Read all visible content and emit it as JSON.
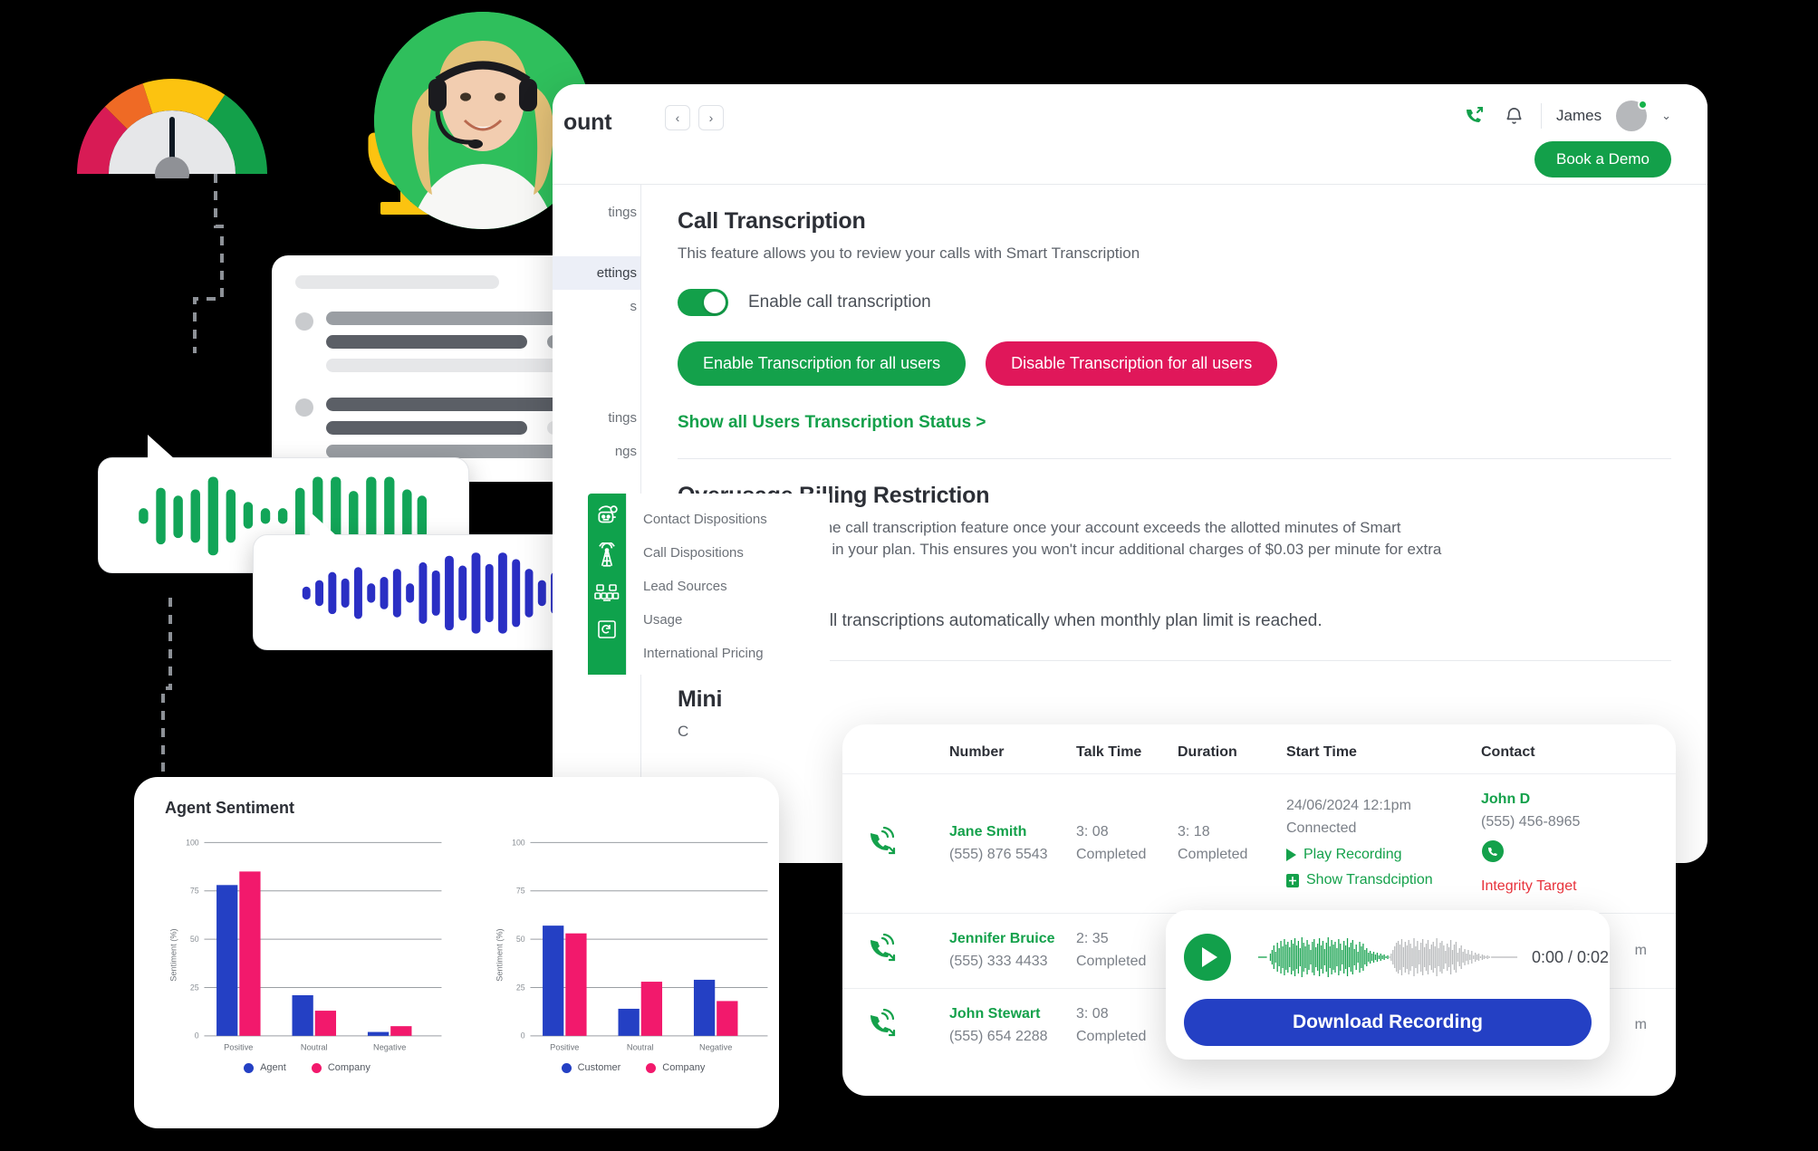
{
  "app": {
    "title": "ount",
    "pager": {
      "prev": "‹",
      "next": "›"
    },
    "user": "James",
    "caret": "⌄",
    "book_demo": "Book a Demo"
  },
  "sidebar": {
    "items": [
      {
        "label": "tings",
        "active": false
      },
      {
        "label": "ettings",
        "active": true
      },
      {
        "label": "s",
        "active": false
      },
      {
        "label": "tings",
        "active": false
      },
      {
        "label": "ngs",
        "active": false
      },
      {
        "label": "Contact Dispositions",
        "active": false
      },
      {
        "label": "Call Dispositions",
        "active": false
      },
      {
        "label": "Lead Sources",
        "active": false
      },
      {
        "label": "Usage",
        "active": false
      },
      {
        "label": "International Pricing",
        "active": false
      }
    ],
    "icons": [
      "robot-icon",
      "tower-icon",
      "grid-icon",
      "refresh-icon"
    ]
  },
  "transcription": {
    "title": "Call Transcription",
    "subtitle": "This feature allows you to review your calls with Smart Transcription",
    "toggle_label": "Enable call transcription",
    "toggle_on": true,
    "enable_all": "Enable Transcription for all users",
    "disable_all": "Disable Transcription for all users",
    "status_link": "Show all Users Transcription Status >"
  },
  "overusage": {
    "title": "Overusage Billing Restriction",
    "body": "Automatically pause the call transcription feature once your account exceeds the allotted minutes of Smart Transcription included in your plan. This ensures you won't incur additional charges of $0.03 per minute for extra transcription minutes.",
    "toggle_label": "Turn off call transcriptions automatically when monthly plan limit is reached.",
    "toggle_on": false
  },
  "third_section": {
    "title": "Mini",
    "sub": "C"
  },
  "calls": {
    "columns": [
      "Number",
      "Talk Time",
      "Duration",
      "Start Time",
      "Contact"
    ],
    "rows": [
      {
        "icon": "incoming-call-icon",
        "name": "Jane Smith",
        "number": "(555) 876 5543",
        "talk_time": "3: 08",
        "talk_status": "Completed",
        "duration": "3: 18",
        "duration_status": "Completed",
        "start_time": "24/06/2024 12:1pm",
        "start_status": "Connected",
        "play": "Play Recording",
        "transcript": "Show Transdciption",
        "contact_name": "John D",
        "contact_number": "(555) 456-8965",
        "contact_tag": "Integrity Target"
      },
      {
        "icon": "incoming-call-icon",
        "name": "Jennifer Bruice",
        "number": "(555) 333 4433",
        "talk_time": "2: 35",
        "talk_status": "Completed",
        "duration": "",
        "duration_status": "",
        "start_time": "m",
        "start_status": "",
        "play": "",
        "transcript": "",
        "contact_name": "",
        "contact_number": "",
        "contact_tag": ""
      },
      {
        "icon": "incoming-call-icon",
        "name": "John Stewart",
        "number": "(555) 654 2288",
        "talk_time": "3: 08",
        "talk_status": "Completed",
        "duration": "",
        "duration_status": "",
        "start_time": "m",
        "start_status": "",
        "play": "",
        "transcript": "",
        "contact_name": "",
        "contact_number": "",
        "contact_tag": ""
      }
    ]
  },
  "player": {
    "play_icon": "play-icon",
    "time": "0:00 / 0:02",
    "download": "Download Recording",
    "played_color": "#12a04b",
    "remaining_color": "#b6b8ba"
  },
  "sentiment": {
    "title": "Agent Sentiment"
  },
  "colors": {
    "brand_green": "#13a04a",
    "pink": "#e0175a",
    "blue": "#2440c4",
    "red": "#e8333c"
  },
  "chart_data": [
    {
      "type": "bar",
      "title": "Agent Sentiment",
      "categories": [
        "Positive",
        "Noutral",
        "Negative"
      ],
      "series": [
        {
          "name": "Agent",
          "color": "#2440c4",
          "values": [
            78,
            21,
            2
          ]
        },
        {
          "name": "Company",
          "color": "#f2196c",
          "values": [
            85,
            13,
            5
          ]
        }
      ],
      "xlabel": "",
      "ylabel": "Sentiment (%)",
      "ylim": [
        0,
        100
      ],
      "yticks": [
        0,
        25,
        50,
        75,
        100
      ],
      "grid": true,
      "legend": "bottom"
    },
    {
      "type": "bar",
      "title": "",
      "categories": [
        "Positive",
        "Noutral",
        "Negative"
      ],
      "series": [
        {
          "name": "Customer",
          "color": "#2440c4",
          "values": [
            57,
            14,
            29
          ]
        },
        {
          "name": "Company",
          "color": "#f2196c",
          "values": [
            53,
            28,
            18
          ]
        }
      ],
      "xlabel": "",
      "ylabel": "Sentiment (%)",
      "ylim": [
        0,
        100
      ],
      "yticks": [
        0,
        25,
        50,
        75,
        100
      ],
      "grid": true,
      "legend": "bottom"
    }
  ],
  "gauge": {
    "name": "sentiment-gauge",
    "segments": [
      "#d81b55",
      "#ef6a25",
      "#fcc310",
      "#13a04a"
    ],
    "needle_value": 50
  }
}
